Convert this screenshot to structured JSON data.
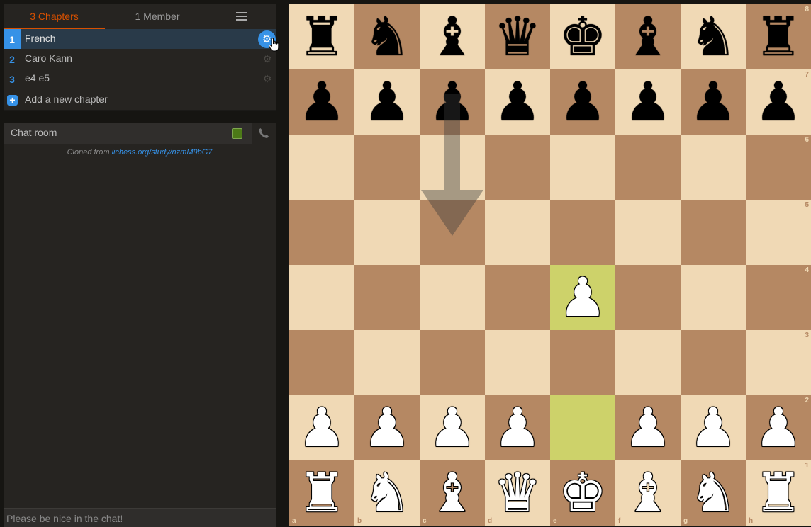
{
  "tabs": {
    "chapters": "3 Chapters",
    "members": "1 Member",
    "menu_icon": "hamburger-icon"
  },
  "chapters": [
    {
      "number": "1",
      "name": "French",
      "active": true
    },
    {
      "number": "2",
      "name": "Caro Kann",
      "active": false
    },
    {
      "number": "3",
      "name": "e4 e5",
      "active": false
    }
  ],
  "add_chapter": {
    "label": "Add a new chapter"
  },
  "chat": {
    "title": "Chat room",
    "cloned_prefix": "Cloned from",
    "cloned_link": "lichess.org/study/nzmM9bG7",
    "input_placeholder": "Please be nice in the chat!"
  },
  "colors": {
    "accent_orange": "#d85000",
    "accent_blue": "#3692e7",
    "light_square": "#f0d9b5",
    "dark_square": "#b58863",
    "last_move": "#cdd26a"
  },
  "board": {
    "files": [
      "a",
      "b",
      "c",
      "d",
      "e",
      "f",
      "g",
      "h"
    ],
    "ranks": [
      "8",
      "7",
      "6",
      "5",
      "4",
      "3",
      "2",
      "1"
    ],
    "position": [
      [
        "bR",
        "bN",
        "bB",
        "bQ",
        "bK",
        "bB",
        "bN",
        "bR"
      ],
      [
        "bP",
        "bP",
        "bP",
        "bP",
        "bP",
        "bP",
        "bP",
        "bP"
      ],
      [
        "",
        "",
        "",
        "",
        "",
        "",
        "",
        ""
      ],
      [
        "",
        "",
        "",
        "",
        "",
        "",
        "",
        ""
      ],
      [
        "",
        "",
        "",
        "",
        "wP",
        "",
        "",
        ""
      ],
      [
        "",
        "",
        "",
        "",
        "",
        "",
        "",
        ""
      ],
      [
        "wP",
        "wP",
        "wP",
        "wP",
        "",
        "wP",
        "wP",
        "wP"
      ],
      [
        "wR",
        "wN",
        "wB",
        "wQ",
        "wK",
        "wB",
        "wN",
        "wR"
      ]
    ],
    "last_move": [
      "e2",
      "e4"
    ],
    "arrow": {
      "from": "c7",
      "to": "c5"
    }
  }
}
